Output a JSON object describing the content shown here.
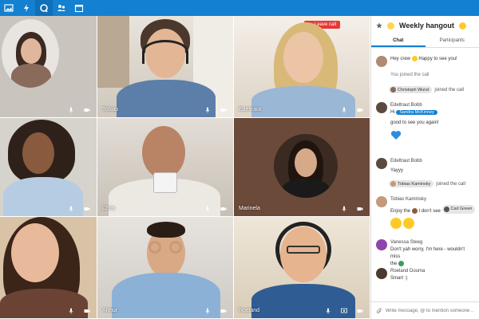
{
  "topbar": {
    "icons": [
      "image-icon",
      "activity-icon",
      "talk-icon",
      "contacts-icon",
      "calendar-icon"
    ],
    "accent": "#1480d0"
  },
  "grid": {
    "leave_label": "Leave call",
    "tiles": [
      {
        "name": ""
      },
      {
        "name": "Tobias"
      },
      {
        "name": "Edeltraut"
      },
      {
        "name": ""
      },
      {
        "name": "Chris"
      },
      {
        "name": "Marinela"
      },
      {
        "name": ""
      },
      {
        "name": "Arthur"
      },
      {
        "name": "Roeland"
      }
    ]
  },
  "sidebar": {
    "title": "Weekly hangout",
    "tabs": [
      "Chat",
      "Participants"
    ],
    "messages": {
      "m1_text": "Hey crew",
      "m1_text2": "Happy to see you!",
      "joined_you": "You joined the call",
      "chip1": "Christoph Wurst",
      "joined_suffix": "joined the call",
      "m2_sender": "Edeltraut Bobb",
      "m2_hi": "Hi",
      "m2_mention": "Sandra McKinney",
      "m2_text": "good to see you again!",
      "m3_sender": "Edeltraut Bobb",
      "m3_text": "Yayyy",
      "chip2": "Tobias Kaminsky",
      "m4_sender": "Tobias Kaminsky",
      "m4_text": "Enjoy the",
      "m4_text2": "I don't see",
      "m4_chip": "Carl Green",
      "m5_sender": "Vanessa Steeg",
      "m5_text": "Don't yah worry, I'm here - wouldn't miss",
      "m5_text2": "the",
      "m6_sender": "Roeland Douma",
      "m6_text": "Smart :)"
    },
    "composer_placeholder": "Write message, @ to mention someone ..."
  }
}
